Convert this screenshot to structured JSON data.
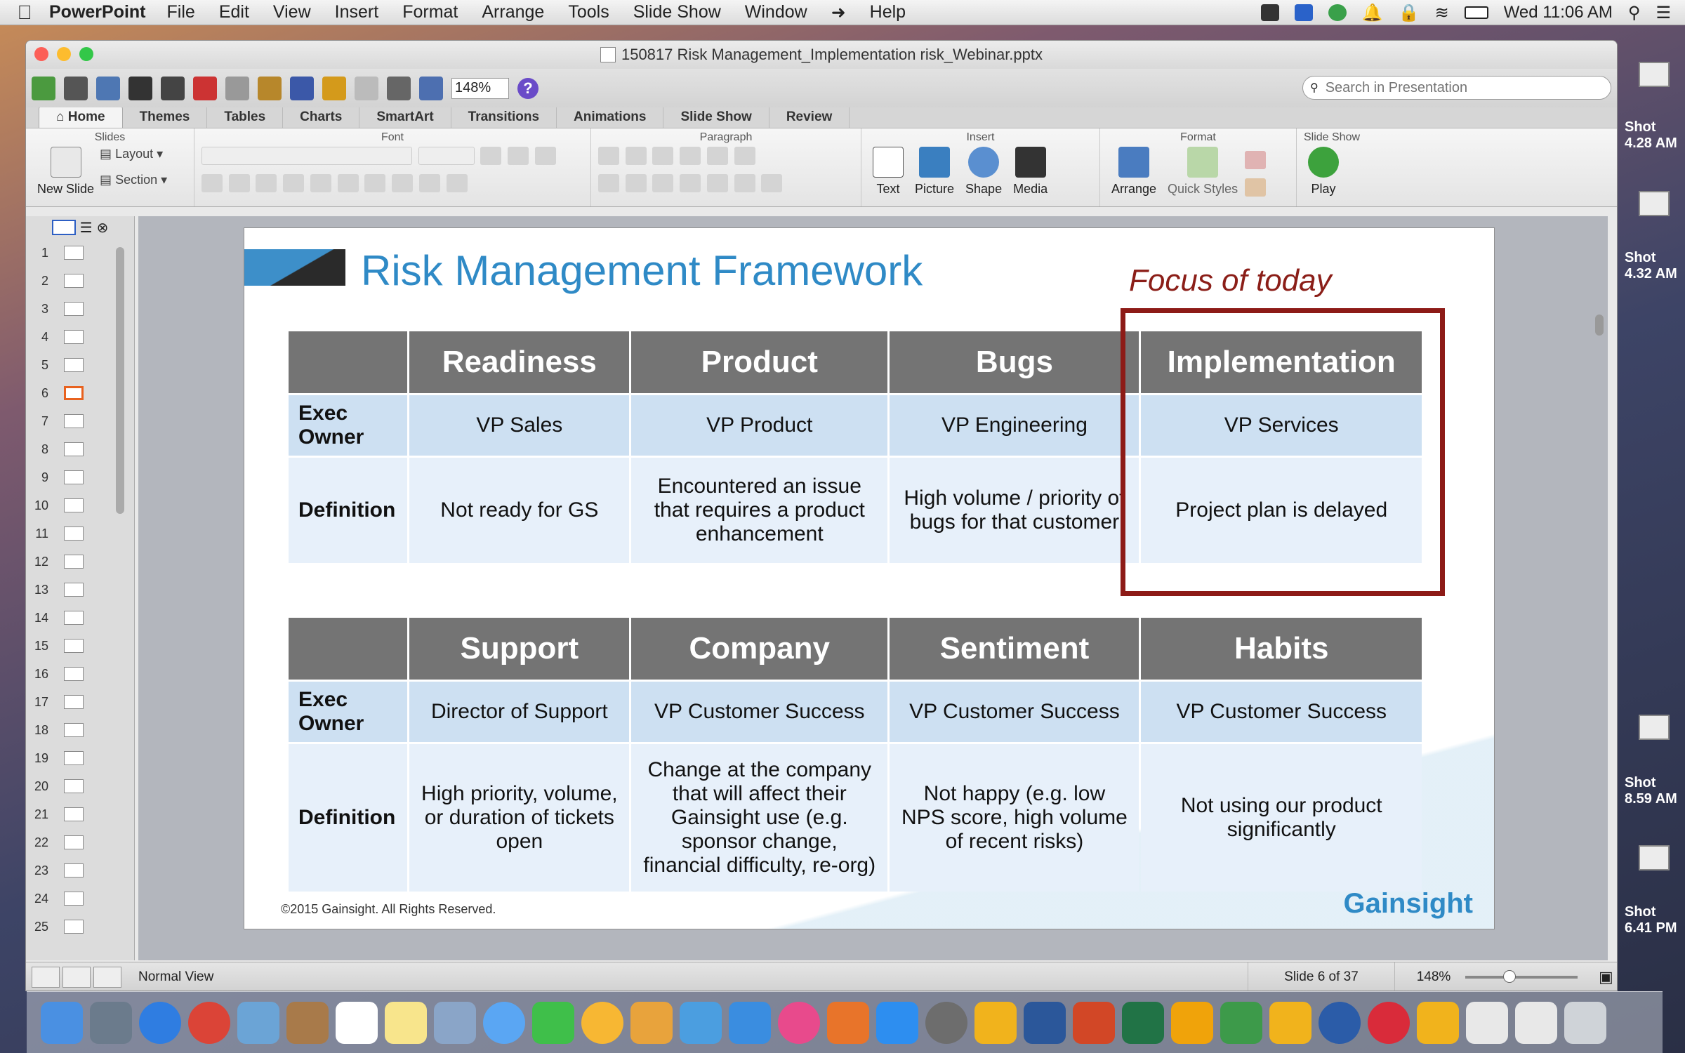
{
  "menubar": {
    "app_name": "PowerPoint",
    "items": [
      "File",
      "Edit",
      "View",
      "Insert",
      "Format",
      "Arrange",
      "Tools",
      "Slide Show",
      "Window",
      "Help"
    ],
    "clock": "Wed 11:06 AM"
  },
  "desktop": {
    "items": [
      {
        "label": "Shot",
        "time": "4.28 AM"
      },
      {
        "label": "Shot",
        "time": "4.32 AM"
      },
      {
        "label": "Shot",
        "time": "8.59 AM"
      },
      {
        "label": "Shot",
        "time": "6.41 PM"
      }
    ]
  },
  "window": {
    "title": "150817 Risk Management_Implementation risk_Webinar.pptx"
  },
  "toolbar": {
    "zoom": "148%",
    "search_placeholder": "Search in Presentation"
  },
  "ribbon": {
    "tabs": [
      "Home",
      "Themes",
      "Tables",
      "Charts",
      "SmartArt",
      "Transitions",
      "Animations",
      "Slide Show",
      "Review"
    ],
    "groups": [
      "Slides",
      "Font",
      "Paragraph",
      "Insert",
      "Format",
      "Slide Show"
    ],
    "slides_buttons": {
      "new_slide": "New Slide",
      "layout": "Layout",
      "section": "Section"
    },
    "insert_buttons": [
      "Text",
      "Picture",
      "Shape",
      "Media"
    ],
    "format_buttons": [
      "Arrange",
      "Quick Styles"
    ],
    "slideshow_buttons": [
      "Play"
    ]
  },
  "slide_panel": {
    "numbers": [
      "1",
      "2",
      "3",
      "4",
      "5",
      "6",
      "7",
      "8",
      "9",
      "10",
      "11",
      "12",
      "13",
      "14",
      "15",
      "16",
      "17",
      "18",
      "19",
      "20",
      "21",
      "22",
      "23",
      "24",
      "25"
    ],
    "selected": 6
  },
  "slide": {
    "title": "Risk Management Framework",
    "focus_label": "Focus of today",
    "table1": {
      "headers": [
        "Readiness",
        "Product",
        "Bugs",
        "Implementation"
      ],
      "row_labels": [
        "Exec Owner",
        "Definition"
      ],
      "owners": [
        "VP Sales",
        "VP Product",
        "VP Engineering",
        "VP Services"
      ],
      "definitions": [
        "Not ready for GS",
        "Encountered an issue that requires a product enhancement",
        "High volume / priority of bugs for that customer",
        "Project plan is delayed"
      ]
    },
    "table2": {
      "headers": [
        "Support",
        "Company",
        "Sentiment",
        "Habits"
      ],
      "row_labels": [
        "Exec Owner",
        "Definition"
      ],
      "owners": [
        "Director of Support",
        "VP Customer Success",
        "VP Customer Success",
        "VP Customer Success"
      ],
      "definitions": [
        "High priority, volume, or duration of tickets open",
        "Change at the company that will affect their Gainsight use (e.g. sponsor change, financial difficulty, re-org)",
        "Not happy (e.g. low NPS score, high volume of recent risks)",
        "Not using our product significantly"
      ]
    },
    "copyright": "©2015 Gainsight. All Rights Reserved.",
    "brand": "Gainsight"
  },
  "statusbar": {
    "view": "Normal View",
    "slide_counter": "Slide 6 of 37",
    "zoom": "148%"
  },
  "colors": {
    "title_blue": "#2f8ac6",
    "focus_red": "#8d1b17",
    "header_gray": "#747474",
    "owner_row": "#cde0f2",
    "definition_row": "#e7f0fa"
  }
}
